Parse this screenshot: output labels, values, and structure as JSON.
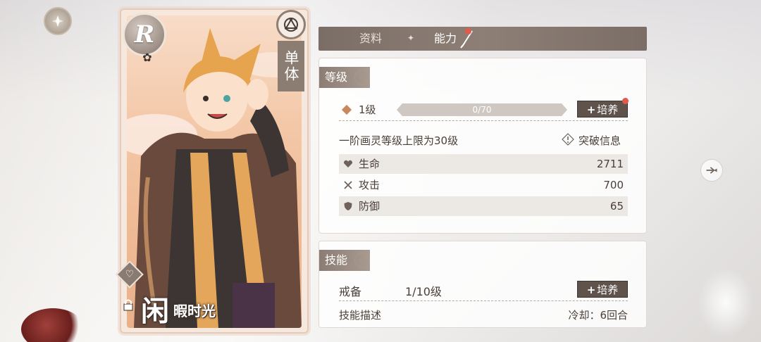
{
  "card": {
    "rarity": "R",
    "type_label": "单体",
    "name_big": "闲",
    "name_small": "暇时光"
  },
  "tabs": [
    {
      "label": "资料",
      "active": false
    },
    {
      "label": "能力",
      "active": true
    }
  ],
  "level_section": {
    "title": "等级",
    "level": "1级",
    "exp_text": "0/70",
    "exp_progress": 0.0,
    "train_label": "培养",
    "cap_text": "一阶画灵等级上限为30级",
    "breakthrough_label": "突破信息",
    "stats": [
      {
        "icon": "heart-icon",
        "name": "生命",
        "value": "2711"
      },
      {
        "icon": "crossed-swords-icon",
        "name": "攻击",
        "value": "700"
      },
      {
        "icon": "shield-icon",
        "name": "防御",
        "value": "65"
      }
    ]
  },
  "skill_section": {
    "title": "技能",
    "skill_name": "戒备",
    "skill_level": "1/10级",
    "train_label": "培养",
    "desc_label": "技能描述",
    "cooldown": "冷却：6回合"
  },
  "colors": {
    "accent_brown": "#8b7d74",
    "button_dark": "#5f534c",
    "notify_red": "#e05a4e",
    "diamond": "#c9895e"
  }
}
